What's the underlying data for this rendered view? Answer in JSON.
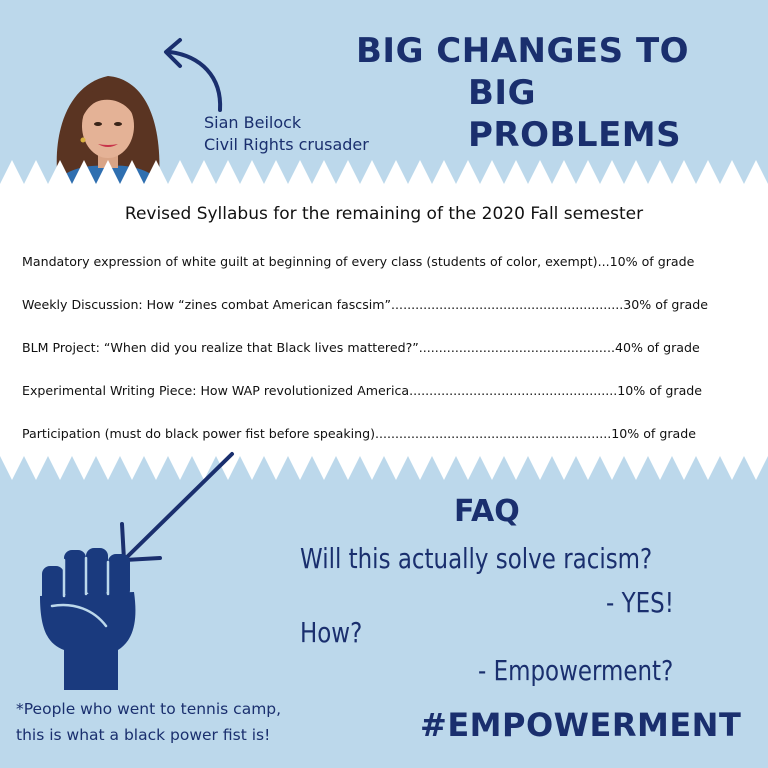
{
  "header": {
    "title_line1": "BIG CHANGES TO",
    "title_line2": "BIG PROBLEMS"
  },
  "person": {
    "name": "Sian Beilock",
    "description": "Civil Rights crusader"
  },
  "syllabus": {
    "title": "Revised Syllabus for the remaining of the 2020 Fall semester",
    "items": [
      "Mandatory expression of white guilt at beginning of every class (students of color, exempt)...10% of grade",
      "Weekly Discussion: How “zines combat American fascsim”..........................................................30% of grade",
      "BLM Project: “When did you realize that Black lives mattered?”.................................................40% of grade",
      "Experimental Writing Piece: How WAP revolutionized America....................................................10% of grade",
      "Participation (must do black power fist before speaking)...........................................................10% of grade"
    ]
  },
  "faq": {
    "heading": "FAQ",
    "question1": "Will this actually solve racism?",
    "answer1": "- YES!",
    "question2": "How?",
    "answer2": "- Empowerment?"
  },
  "footnote": {
    "line1": "*People who went to tennis camp,",
    "line2": "this is what a black power fist is!"
  },
  "hashtag": "#EMPOWERMENT",
  "colors": {
    "background": "#bcd8eb",
    "navy": "#1a2f6e",
    "sheet": "#ffffff"
  },
  "icons": {
    "top_arrow": "curved-arrow-icon",
    "bottom_arrow": "diagonal-arrow-icon",
    "fist": "raised-fist-icon"
  }
}
